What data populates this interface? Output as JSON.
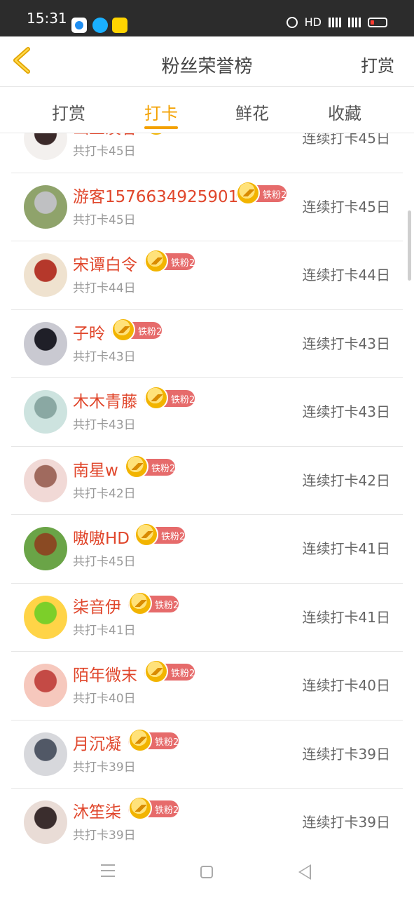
{
  "status_bar": {
    "time": "15:31",
    "right_text": "HD"
  },
  "header": {
    "title": "粉丝荣誉榜",
    "action_label": "打赏",
    "back_icon": "chevron-left-icon",
    "accent_color": "#f3a100"
  },
  "tabs": [
    {
      "label": "打赏",
      "active": false
    },
    {
      "label": "打卡",
      "active": true
    },
    {
      "label": "鲜花",
      "active": false
    },
    {
      "label": "收藏",
      "active": false
    }
  ],
  "badge_label": "铁粉2",
  "rows": [
    {
      "name": "幽兰溪谷",
      "total": "共打卡45日",
      "streak": "连续打卡45日"
    },
    {
      "name": "游客1576634925901",
      "total": "共打卡45日",
      "streak": "连续打卡45日"
    },
    {
      "name": "宋谭白令",
      "total": "共打卡44日",
      "streak": "连续打卡44日"
    },
    {
      "name": "子昤",
      "total": "共打卡43日",
      "streak": "连续打卡43日"
    },
    {
      "name": "木木青藤",
      "total": "共打卡43日",
      "streak": "连续打卡43日"
    },
    {
      "name": "南星w",
      "total": "共打卡42日",
      "streak": "连续打卡42日"
    },
    {
      "name": "嗷嗷HD",
      "total": "共打卡45日",
      "streak": "连续打卡41日"
    },
    {
      "name": "柒音伊",
      "total": "共打卡41日",
      "streak": "连续打卡41日"
    },
    {
      "name": "陌年微末",
      "total": "共打卡40日",
      "streak": "连续打卡40日"
    },
    {
      "name": "月沉凝",
      "total": "共打卡39日",
      "streak": "连续打卡39日"
    },
    {
      "name": "沐笙柒",
      "total": "共打卡39日",
      "streak": "连续打卡39日"
    }
  ]
}
